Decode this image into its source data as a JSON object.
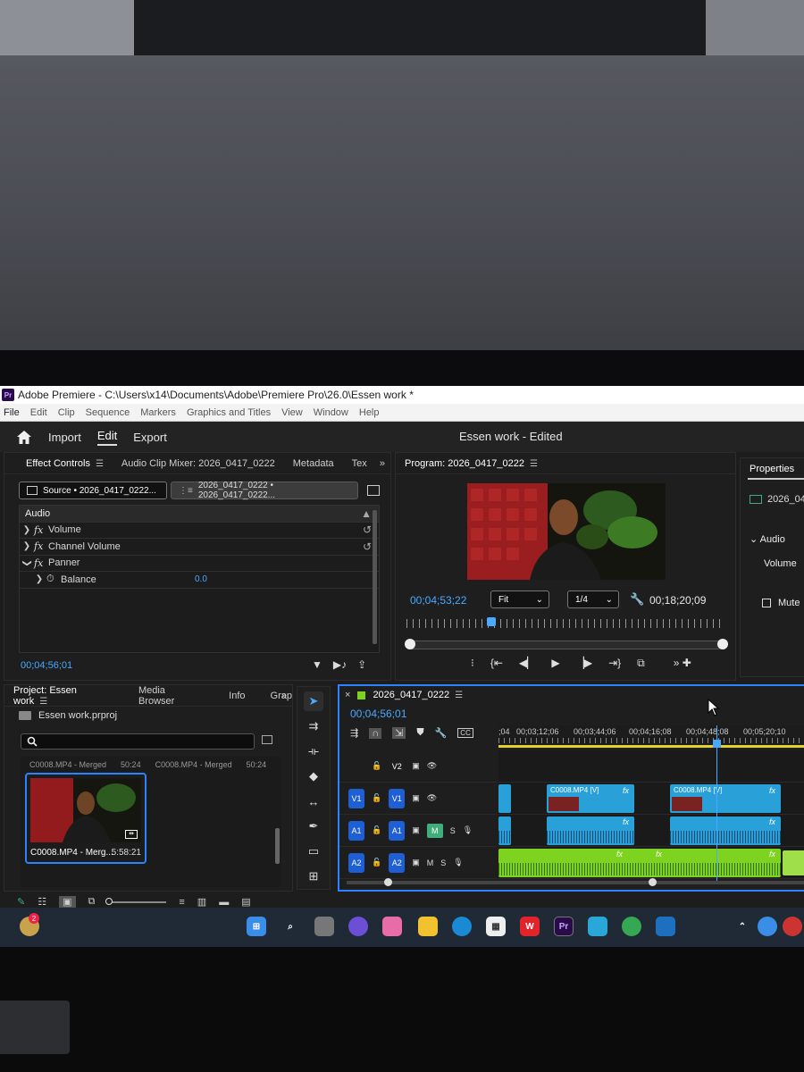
{
  "window": {
    "title": "Adobe Premiere - C:\\Users\\x14\\Documents\\Adobe\\Premiere Pro\\26.0\\Essen work *",
    "app_badge": "Pr"
  },
  "menu": [
    "File",
    "Edit",
    "Clip",
    "Sequence",
    "Markers",
    "Graphics and Titles",
    "View",
    "Window",
    "Help"
  ],
  "header": {
    "tabs": [
      "Import",
      "Edit",
      "Export"
    ],
    "active_tab": "Edit",
    "document_title": "Essen work - Edited"
  },
  "effect_controls": {
    "tabs": [
      "Effect Controls",
      "Audio Clip Mixer: 2026_0417_0222",
      "Metadata",
      "Tex"
    ],
    "source_chip": "Source • 2026_0417_0222...",
    "sequence_chip": "2026_0417_0222 • 2026_0417_0222...",
    "section": "Audio",
    "rows": [
      {
        "label": "Volume",
        "fx": true
      },
      {
        "label": "Channel Volume",
        "fx": true
      },
      {
        "label": "Panner",
        "fx": true
      },
      {
        "label": "Balance",
        "value": "0.0"
      }
    ],
    "timecode": "00;04;56;01"
  },
  "program_monitor": {
    "tab": "Program: 2026_0417_0222",
    "timecode_current": "00;04;53;22",
    "fit": "Fit",
    "resolution": "1/4",
    "timecode_duration": "00;18;20;09"
  },
  "properties": {
    "tab": "Properties",
    "clip": "2026_04",
    "section": "Audio",
    "volume_label": "Volume",
    "mute_label": "Mute"
  },
  "project": {
    "tabs": [
      "Project: Essen work",
      "Media Browser",
      "Info",
      "Grap"
    ],
    "file": "Essen work.prproj",
    "bin_header": [
      "C0008.MP4 - Merged",
      "50:24",
      "C0008.MP4 - Merged",
      "50:24"
    ],
    "thumb_name": "C0008.MP4 - Merg...",
    "thumb_duration": "5:58:21"
  },
  "timeline": {
    "tab": "2026_0417_0222",
    "timecode": "00;04;56;01",
    "ruler_labels": [
      ";04",
      "00;03;12;06",
      "00;03;44;06",
      "00;04;16;08",
      "00;04;48;08",
      "00;05;20;10"
    ],
    "tracks": {
      "v2": {
        "source": "",
        "target": "V2"
      },
      "v1": {
        "source": "V1",
        "target": "V1"
      },
      "a1": {
        "source": "A1",
        "target": "A1",
        "m": "M",
        "s": "S"
      },
      "a2": {
        "source": "A2",
        "target": "A2",
        "m": "M",
        "s": "S"
      }
    },
    "clip_labels": [
      "C0008.MP4 [V]",
      "C0008.MP4 [V]"
    ],
    "fx_badge": "fx"
  },
  "taskbar": {
    "notification_count": "2"
  },
  "colors": {
    "accent_blue": "#2b84ff",
    "timecode_blue": "#4aa8ff",
    "clip_video": "#2aa0d8",
    "clip_audio_green": "#7ed321"
  }
}
